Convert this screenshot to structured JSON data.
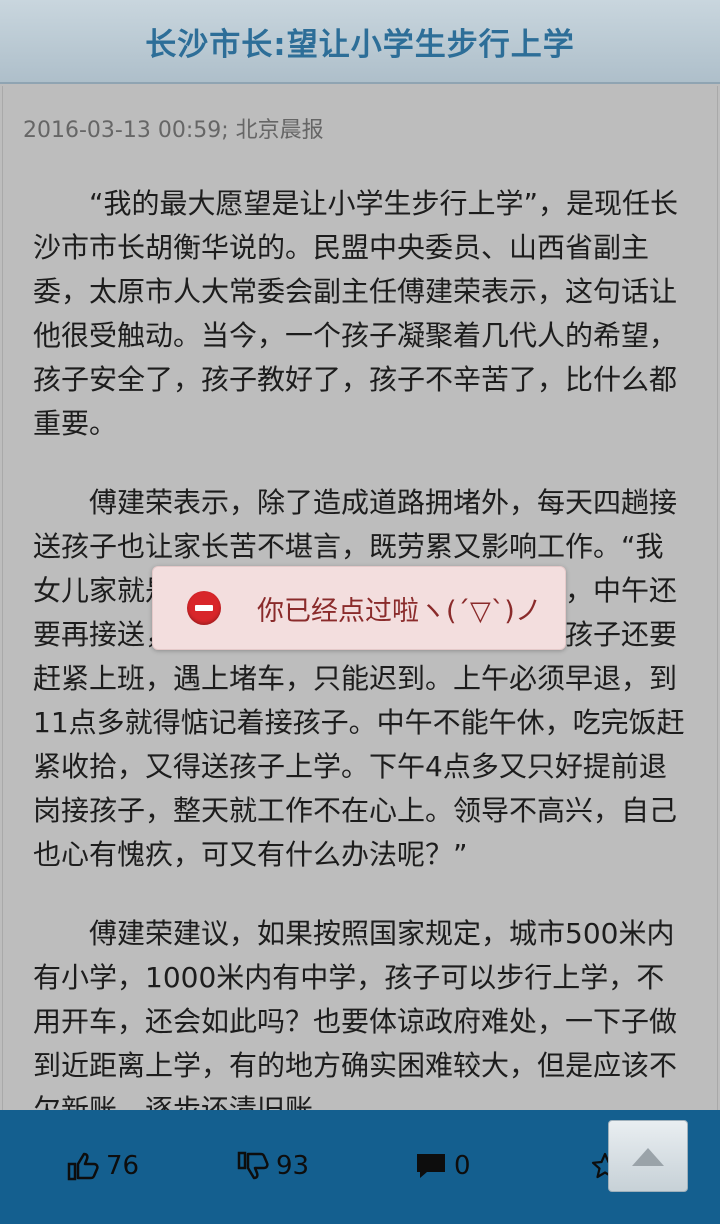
{
  "header": {
    "title": "长沙市长:望让小学生步行上学"
  },
  "article": {
    "meta": "2016-03-13 00:59; 北京晨报",
    "paragraphs": [
      "“我的最大愿望是让小学生步行上学”，是现任长沙市市长胡衡华说的。民盟中央委员、山西省副主委，太原市人大常委会副主任傅建荣表示，这句话让他很受触动。当今，一个孩子凝聚着几代人的希望，孩子安全了，孩子教好了，孩子不辛苦了，比什么都重要。",
      "傅建荣表示，除了造成道路拥堵外，每天四趟接送孩子也让家长苦不堪言，既劳累又影响工作。“我女儿家就是这样，早晨送孩子，晚上接孩子，中午还要再接送，一天四趟接送，家长们早晨送完孩子还要赶紧上班，遇上堵车，只能迟到。上午必须早退，到11点多就得惦记着接孩子。中午不能午休，吃完饭赶紧收拾，又得送孩子上学。下午4点多又只好提前退岗接孩子，整天就工作不在心上。领导不高兴，自己也心有愧疚，可又有什么办法呢？”",
      "傅建荣建议，如果按照国家规定，城市500米内有小学，1000米内有中学，孩子可以步行上学，不用开车，还会如此吗？也要体谅政府难处，一下子做到近距离上学，有的地方确实困难较大，但是应该不欠新账，逐步还清旧账。"
    ]
  },
  "toast": {
    "icon": "no-entry-icon",
    "message": "你已经点过啦ヽ(ˊ▽ˋ)ノ"
  },
  "bottom_bar": {
    "like_count": "76",
    "dislike_count": "93",
    "comment_count": "0",
    "icons": [
      "thumbs-up-icon",
      "thumbs-down-icon",
      "comment-icon",
      "star-icon",
      "scroll-to-top-icon"
    ]
  },
  "colors": {
    "header_title": "#2d6e98",
    "bottom_bar": "#145f8f",
    "toast_bg": "#f3dede",
    "toast_icon": "#d8262a"
  }
}
